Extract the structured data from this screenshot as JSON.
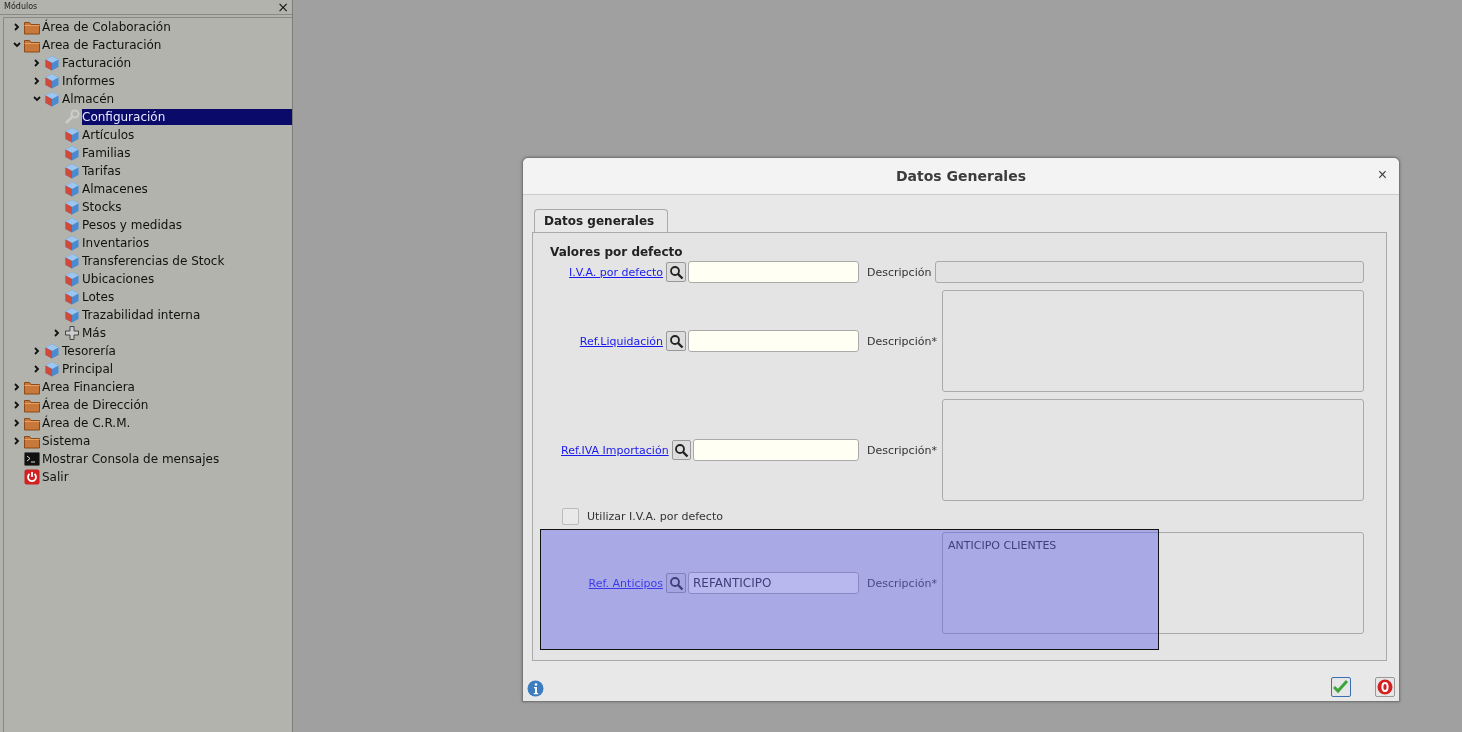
{
  "sidebar": {
    "title": "Módulos",
    "close": "×",
    "tree": [
      {
        "label": "Área de Colaboración",
        "kind": "folder",
        "expanded": false
      },
      {
        "label": "Area de Facturación",
        "kind": "folder",
        "expanded": true,
        "children": [
          {
            "label": "Facturación",
            "kind": "module",
            "expanded": false
          },
          {
            "label": "Informes",
            "kind": "module",
            "expanded": false
          },
          {
            "label": "Almacén",
            "kind": "module",
            "expanded": true,
            "children": [
              {
                "label": "Configuración",
                "kind": "tool",
                "selected": true
              },
              {
                "label": "Artículos",
                "kind": "module",
                "selected": false
              },
              {
                "label": "Familias",
                "kind": "module",
                "selected": false
              },
              {
                "label": "Tarifas",
                "kind": "module",
                "selected": false
              },
              {
                "label": "Almacenes",
                "kind": "module",
                "selected": false
              },
              {
                "label": "Stocks",
                "kind": "module",
                "selected": false
              },
              {
                "label": "Pesos y medidas",
                "kind": "module",
                "selected": false
              },
              {
                "label": "Inventarios",
                "kind": "module",
                "selected": false
              },
              {
                "label": "Transferencias de Stock",
                "kind": "module",
                "selected": false
              },
              {
                "label": "Ubicaciones",
                "kind": "module",
                "selected": false
              },
              {
                "label": "Lotes",
                "kind": "module",
                "selected": false
              },
              {
                "label": "Trazabilidad interna",
                "kind": "module",
                "selected": false
              },
              {
                "label": "Más",
                "kind": "plus",
                "expanded": false
              }
            ]
          },
          {
            "label": "Tesorería",
            "kind": "module",
            "expanded": false
          },
          {
            "label": "Principal",
            "kind": "module",
            "expanded": false
          }
        ]
      },
      {
        "label": "Area Financiera",
        "kind": "folder",
        "expanded": false
      },
      {
        "label": "Área de Dirección",
        "kind": "folder",
        "expanded": false
      },
      {
        "label": "Área de C.R.M.",
        "kind": "folder",
        "expanded": false
      },
      {
        "label": "Sistema",
        "kind": "folder",
        "expanded": false
      },
      {
        "label": "Mostrar Consola de mensajes",
        "kind": "console"
      },
      {
        "label": "Salir",
        "kind": "exit"
      }
    ]
  },
  "dialog": {
    "title": "Datos Generales",
    "close": "×",
    "tabs": [
      {
        "label": "Datos generales",
        "selected": true
      }
    ],
    "section_title": "Valores por defecto",
    "rows": [
      {
        "kind": "single",
        "label": "I.V.A. por defecto",
        "value": "",
        "desc_label": "Descripción",
        "description": ""
      },
      {
        "kind": "multi",
        "label": "Ref.Liquidación",
        "value": "",
        "desc_label": "Descripción*",
        "description": ""
      },
      {
        "kind": "multi",
        "label": "Ref.IVA Importación",
        "value": "",
        "desc_label": "Descripción*",
        "description": ""
      },
      {
        "kind": "checkbox",
        "label": "Utilizar I.V.A. por defecto",
        "checked": false
      },
      {
        "kind": "multi",
        "label": "Ref. Anticipos",
        "value": "REFANTICIPO",
        "desc_label": "Descripción*",
        "description": "ANTICIPO CLIENTES",
        "highlighted": true
      }
    ]
  }
}
